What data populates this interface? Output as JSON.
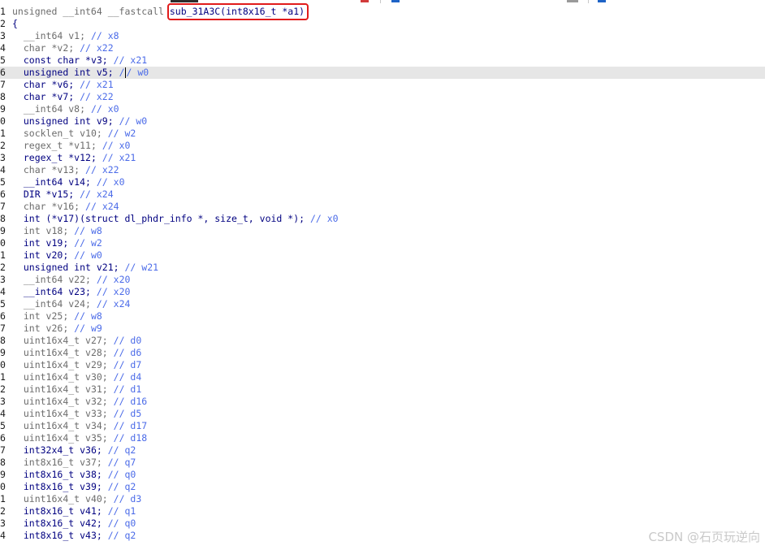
{
  "editor": {
    "header": {
      "prefix": "unsigned __int64 __fastcall ",
      "function": "sub_31A3C(int8x16_t *a1)"
    },
    "lines": [
      {
        "n": "1",
        "code": "",
        "header": true
      },
      {
        "n": "2",
        "code": "{"
      },
      {
        "n": "3",
        "type": "__int64 v1;",
        "comment": "// x8",
        "style": "g"
      },
      {
        "n": "4",
        "type": "char *v2;",
        "comment": "// x22",
        "style": "g"
      },
      {
        "n": "5",
        "type": "const char *v3;",
        "comment": "// x21",
        "style": "b"
      },
      {
        "n": "6",
        "type": "unsigned int v5;",
        "comment": "/",
        "comment2": "/ w0",
        "style": "b",
        "highlight": true
      },
      {
        "n": "7",
        "type": "char *v6;",
        "comment": "// x21",
        "style": "b"
      },
      {
        "n": "8",
        "type": "char *v7;",
        "comment": "// x22",
        "style": "b"
      },
      {
        "n": "9",
        "type": "__int64 v8;",
        "comment": "// x0",
        "style": "g"
      },
      {
        "n": "0",
        "type": "unsigned int v9;",
        "comment": "// w0",
        "style": "b"
      },
      {
        "n": "1",
        "type": "socklen_t v10;",
        "comment": "// w2",
        "style": "g"
      },
      {
        "n": "2",
        "type": "regex_t *v11;",
        "comment": "// x0",
        "style": "g"
      },
      {
        "n": "3",
        "type": "regex_t *v12;",
        "comment": "// x21",
        "style": "b"
      },
      {
        "n": "4",
        "type": "char *v13;",
        "comment": "// x22",
        "style": "g"
      },
      {
        "n": "5",
        "type": "__int64 v14;",
        "comment": "// x0",
        "style": "b"
      },
      {
        "n": "6",
        "type": "DIR *v15;",
        "comment": "// x24",
        "style": "b"
      },
      {
        "n": "7",
        "type": "char *v16;",
        "comment": "// x24",
        "style": "g"
      },
      {
        "n": "8",
        "type": "int (*v17)(struct dl_phdr_info *, size_t, void *);",
        "comment": "// x0",
        "style": "b"
      },
      {
        "n": "9",
        "type": "int v18;",
        "comment": "// w8",
        "style": "g"
      },
      {
        "n": "0",
        "type": "int v19;",
        "comment": "// w2",
        "style": "b"
      },
      {
        "n": "1",
        "type": "int v20;",
        "comment": "// w0",
        "style": "b"
      },
      {
        "n": "2",
        "type": "unsigned int v21;",
        "comment": "// w21",
        "style": "b"
      },
      {
        "n": "3",
        "type": "__int64 v22;",
        "comment": "// x20",
        "style": "g"
      },
      {
        "n": "4",
        "type": "__int64 v23;",
        "comment": "// x20",
        "style": "b"
      },
      {
        "n": "5",
        "type": "__int64 v24;",
        "comment": "// x24",
        "style": "g"
      },
      {
        "n": "6",
        "type": "int v25;",
        "comment": "// w8",
        "style": "g"
      },
      {
        "n": "7",
        "type": "int v26;",
        "comment": "// w9",
        "style": "g"
      },
      {
        "n": "8",
        "type": "uint16x4_t v27;",
        "comment": "// d0",
        "style": "g"
      },
      {
        "n": "9",
        "type": "uint16x4_t v28;",
        "comment": "// d6",
        "style": "g"
      },
      {
        "n": "0",
        "type": "uint16x4_t v29;",
        "comment": "// d7",
        "style": "g"
      },
      {
        "n": "1",
        "type": "uint16x4_t v30;",
        "comment": "// d4",
        "style": "g"
      },
      {
        "n": "2",
        "type": "uint16x4_t v31;",
        "comment": "// d1",
        "style": "g"
      },
      {
        "n": "3",
        "type": "uint16x4_t v32;",
        "comment": "// d16",
        "style": "g"
      },
      {
        "n": "4",
        "type": "uint16x4_t v33;",
        "comment": "// d5",
        "style": "g"
      },
      {
        "n": "5",
        "type": "uint16x4_t v34;",
        "comment": "// d17",
        "style": "g"
      },
      {
        "n": "6",
        "type": "uint16x4_t v35;",
        "comment": "// d18",
        "style": "g"
      },
      {
        "n": "7",
        "type": "int32x4_t v36;",
        "comment": "// q2",
        "style": "b"
      },
      {
        "n": "8",
        "type": "int8x16_t v37;",
        "comment": "// q7",
        "style": "g"
      },
      {
        "n": "9",
        "type": "int8x16_t v38;",
        "comment": "// q0",
        "style": "b"
      },
      {
        "n": "0",
        "type": "int8x16_t v39;",
        "comment": "// q2",
        "style": "b"
      },
      {
        "n": "1",
        "type": "uint16x4_t v40;",
        "comment": "// d3",
        "style": "g"
      },
      {
        "n": "2",
        "type": "int8x16_t v41;",
        "comment": "// q1",
        "style": "b"
      },
      {
        "n": "3",
        "type": "int8x16_t v42;",
        "comment": "// q0",
        "style": "b"
      },
      {
        "n": "4",
        "type": "int8x16_t v43;",
        "comment": "// q2",
        "style": "b"
      }
    ]
  },
  "colors": {
    "keyword": "#000080",
    "comment": "#4b6be8",
    "grey_var": "#6c6c6c",
    "highlight_line": "#e6e6e6",
    "annotation_box": "#e11b1b"
  },
  "watermark": "CSDN @石页玩逆向"
}
